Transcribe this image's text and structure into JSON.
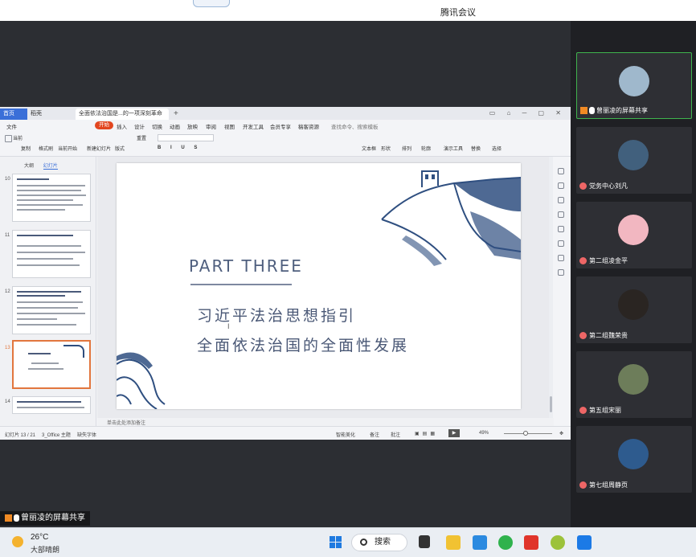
{
  "meeting": {
    "title": "腾讯会议"
  },
  "wps": {
    "tabs": {
      "home": "首页",
      "wps": "稻壳",
      "doc": "全面依法治国是...的一项深刻革命"
    },
    "menus": [
      "文件",
      "开始",
      "插入",
      "设计",
      "切换",
      "动画",
      "放映",
      "审阅",
      "视图",
      "开发工具",
      "会员专享",
      "稿客资源"
    ],
    "menu_active": "开始",
    "search_cmd": "查找命令、搜索模板",
    "ribbon": [
      "当前",
      "复制",
      "格式刷",
      "当前开始",
      "新建幻灯片",
      "版式",
      "重置",
      "文本框",
      "形状",
      "排列",
      "轮廓",
      "演示工具",
      "替换",
      "选择"
    ],
    "panel_tabs": {
      "outline": "大纲",
      "slides": "幻灯片"
    },
    "thumbs": [
      {
        "num": "10"
      },
      {
        "num": "11"
      },
      {
        "num": "12"
      },
      {
        "num": "13"
      },
      {
        "num": "14"
      }
    ],
    "add_slide": "+",
    "slide": {
      "part": "PART THREE",
      "line1": "习近平法治思想指引",
      "line2": "全面依法治国的全面性发展",
      "cursor": "I"
    },
    "notes_placeholder": "单击此处添加备注",
    "status": {
      "slide_count": "幻灯片 13 / 21",
      "theme": "3_Office 主题",
      "missing_font": "缺失字体",
      "smart_beautify": "智能美化",
      "notes": "备注",
      "comments": "批注",
      "zoom": "49%"
    }
  },
  "gallery": [
    {
      "name": "曾丽凌的屏幕共享",
      "share": true,
      "active": true,
      "avatar_color": "#9fb8cc"
    },
    {
      "name": "党务中心刘凡",
      "share": false,
      "active": false,
      "avatar_color": "#41607d"
    },
    {
      "name": "第二组凌金平",
      "share": false,
      "active": false,
      "avatar_color": "#f2b7c1"
    },
    {
      "name": "第二组魏荣贵",
      "share": false,
      "active": false,
      "avatar_color": "#2a2522"
    },
    {
      "name": "第五组宋丽",
      "share": false,
      "active": false,
      "avatar_color": "#6d7d5a"
    },
    {
      "name": "第七组周静页",
      "share": false,
      "active": false,
      "avatar_color": "#2e5b8e"
    }
  ],
  "share_label": "曾丽凌的屏幕共享",
  "taskbar": {
    "temperature": "26°C",
    "weather": "大部晴朗",
    "search": "搜索"
  }
}
